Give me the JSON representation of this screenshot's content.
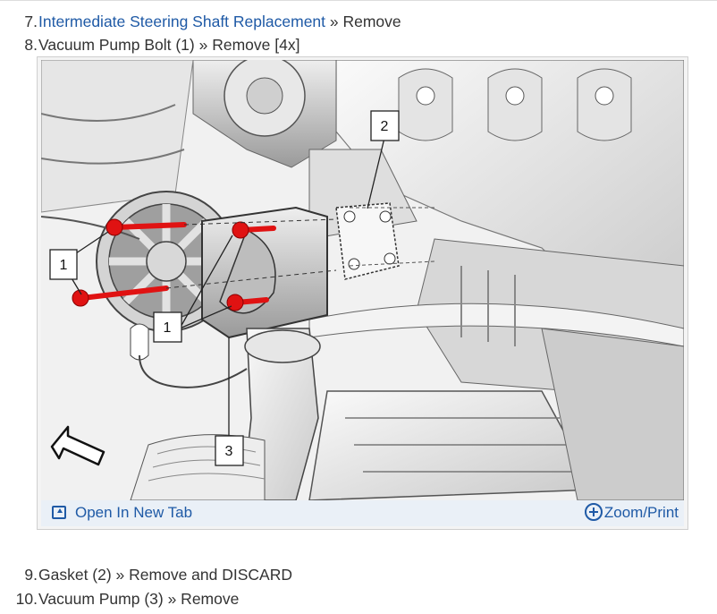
{
  "steps_before": [
    {
      "number": "7.",
      "link_text": "Intermediate Steering Shaft Replacement",
      "rest": " » Remove"
    },
    {
      "number": "8.",
      "text": "Vacuum Pump Bolt (1) » Remove [4x]"
    }
  ],
  "figure": {
    "callouts": [
      "1",
      "2",
      "1",
      "3"
    ],
    "open_tab_label": "Open In New Tab",
    "zoom_print_label": "Zoom/Print",
    "icons": {
      "open_tab": "open-in-new-tab-icon",
      "zoom": "zoom-plus-icon"
    },
    "colors": {
      "bolt": "#e01212",
      "link": "#1f5aa6",
      "caption_bar": "#eaf0f7"
    }
  },
  "steps_after": [
    {
      "number": "9.",
      "text": "Gasket (2) » Remove and DISCARD"
    },
    {
      "number": "10.",
      "text": "Vacuum Pump (3) » Remove"
    }
  ]
}
